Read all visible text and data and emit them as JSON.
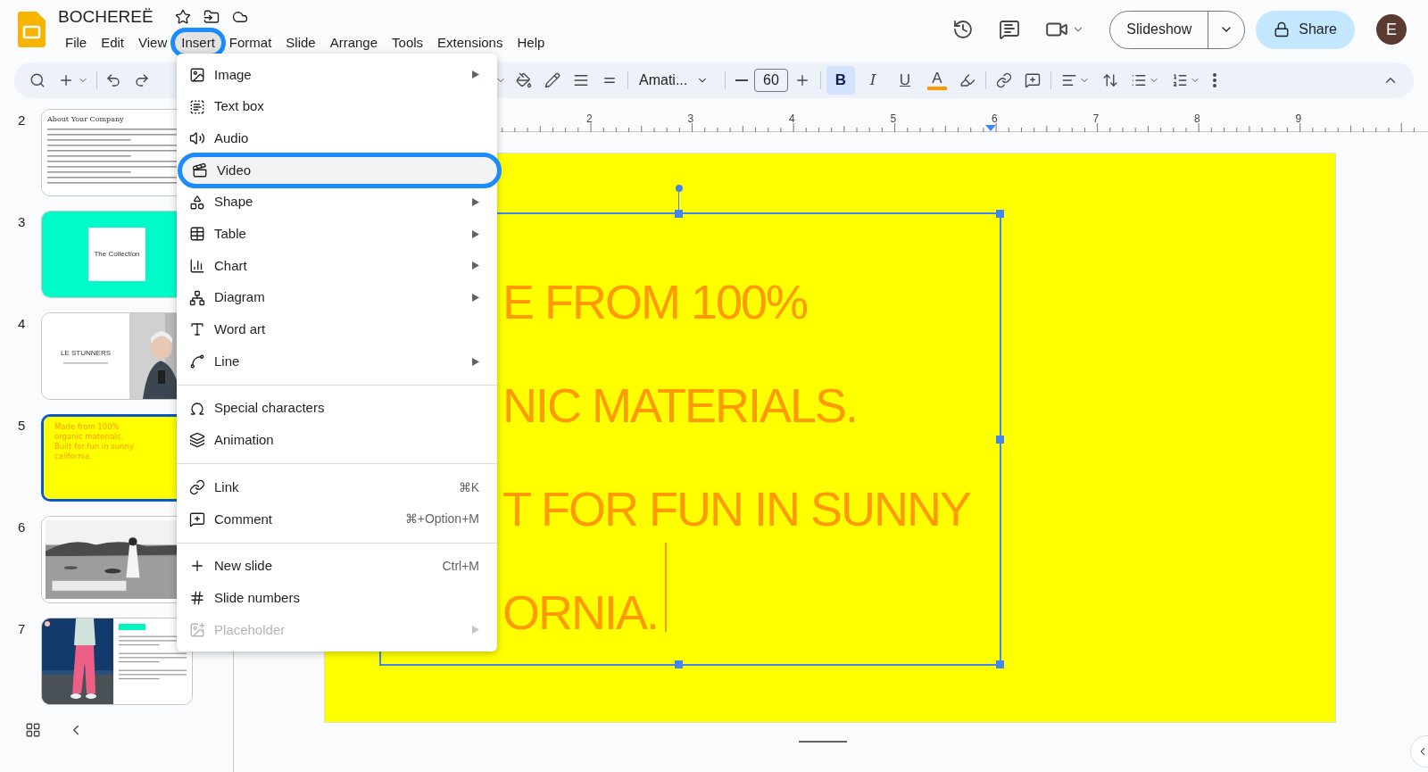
{
  "document": {
    "title": "BOCHEREË"
  },
  "menubar": [
    {
      "label": "File",
      "selected": false
    },
    {
      "label": "Edit",
      "selected": false
    },
    {
      "label": "View",
      "selected": false
    },
    {
      "label": "Insert",
      "selected": true
    },
    {
      "label": "Format",
      "selected": false
    },
    {
      "label": "Slide",
      "selected": false
    },
    {
      "label": "Arrange",
      "selected": false
    },
    {
      "label": "Tools",
      "selected": false
    },
    {
      "label": "Extensions",
      "selected": false
    },
    {
      "label": "Help",
      "selected": false
    }
  ],
  "header": {
    "slideshow": "Slideshow",
    "share": "Share",
    "avatar": "E"
  },
  "toolbar": {
    "font": "Amati...",
    "font_size": "60",
    "formatting": [
      {
        "label": "B",
        "kind": "bold",
        "selected": true
      },
      {
        "label": "I",
        "kind": "italic",
        "selected": false
      },
      {
        "label": "U",
        "kind": "underline",
        "selected": false
      }
    ],
    "text_color": "A"
  },
  "ruler": {
    "ticks": [
      "2",
      "3",
      "4",
      "5",
      "6",
      "7",
      "8",
      "9"
    ]
  },
  "slides": [
    {
      "number": "2",
      "kind": "about",
      "title": "About Your Company",
      "selected": false
    },
    {
      "number": "3",
      "kind": "collection",
      "title": "The Collection",
      "selected": false
    },
    {
      "number": "4",
      "kind": "stunners",
      "title": "LE STUNNERS",
      "selected": false
    },
    {
      "number": "5",
      "kind": "text",
      "lines": [
        "Made from 100%",
        "organic materials.",
        "Built for fun in sunny",
        "california."
      ],
      "selected": true
    },
    {
      "number": "6",
      "selected": false
    },
    {
      "number": "7",
      "kind": "fashion",
      "selected": false
    }
  ],
  "slide": {
    "lines": [
      "E FROM 100%",
      "NIC MATERIALS.",
      "T FOR FUN IN SUNNY",
      "ORNIA."
    ]
  },
  "insert_menu": {
    "groups": [
      [
        {
          "label": "Image",
          "submenu": true,
          "highlighted": false,
          "disabled": false
        },
        {
          "label": "Text box",
          "submenu": false,
          "highlighted": false,
          "disabled": false
        },
        {
          "label": "Audio",
          "submenu": false,
          "highlighted": false,
          "disabled": false
        },
        {
          "label": "Video",
          "submenu": false,
          "highlighted": true,
          "disabled": false
        },
        {
          "label": "Shape",
          "submenu": true,
          "highlighted": false,
          "disabled": false
        },
        {
          "label": "Table",
          "submenu": true,
          "highlighted": false,
          "disabled": false
        },
        {
          "label": "Chart",
          "submenu": true,
          "highlighted": false,
          "disabled": false
        },
        {
          "label": "Diagram",
          "submenu": true,
          "highlighted": false,
          "disabled": false
        },
        {
          "label": "Word art",
          "submenu": false,
          "highlighted": false,
          "disabled": false
        },
        {
          "label": "Line",
          "submenu": true,
          "highlighted": false,
          "disabled": false
        }
      ],
      [
        {
          "label": "Special characters",
          "submenu": false,
          "highlighted": false,
          "disabled": false
        },
        {
          "label": "Animation",
          "submenu": false,
          "highlighted": false,
          "disabled": false
        }
      ],
      [
        {
          "label": "Link",
          "shortcut": "⌘K",
          "submenu": false,
          "highlighted": false,
          "disabled": false
        },
        {
          "label": "Comment",
          "shortcut": "⌘+Option+M",
          "submenu": false,
          "highlighted": false,
          "disabled": false
        }
      ],
      [
        {
          "label": "New slide",
          "shortcut": "Ctrl+M",
          "submenu": false,
          "highlighted": false,
          "disabled": false
        },
        {
          "label": "Slide numbers",
          "submenu": false,
          "highlighted": false,
          "disabled": false
        },
        {
          "label": "Placeholder",
          "submenu": true,
          "highlighted": false,
          "disabled": true
        }
      ]
    ]
  }
}
